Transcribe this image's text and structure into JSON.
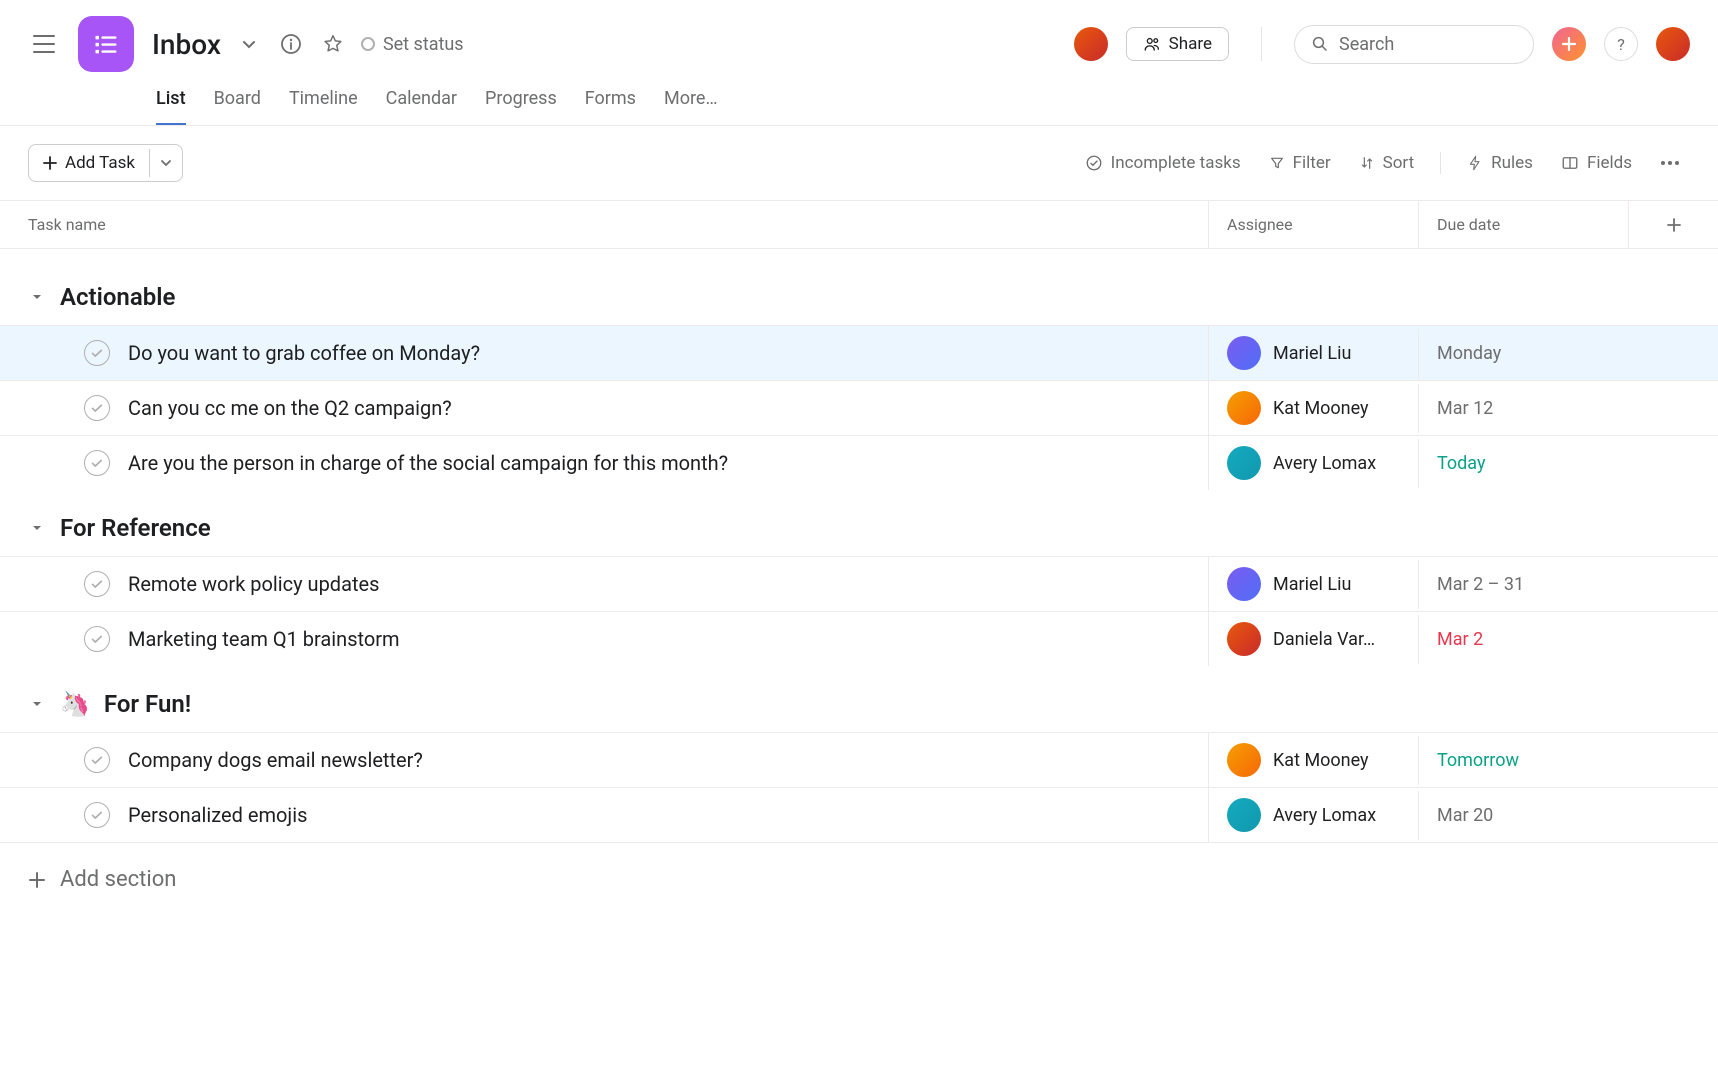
{
  "header": {
    "title": "Inbox",
    "set_status": "Set status",
    "share": "Share",
    "search_placeholder": "Search",
    "help": "?"
  },
  "tabs": {
    "items": [
      {
        "label": "List",
        "active": true
      },
      {
        "label": "Board",
        "active": false
      },
      {
        "label": "Timeline",
        "active": false
      },
      {
        "label": "Calendar",
        "active": false
      },
      {
        "label": "Progress",
        "active": false
      },
      {
        "label": "Forms",
        "active": false
      },
      {
        "label": "More…",
        "active": false
      }
    ]
  },
  "toolbar": {
    "add_task": "Add Task",
    "incomplete": "Incomplete tasks",
    "filter": "Filter",
    "sort": "Sort",
    "rules": "Rules",
    "fields": "Fields"
  },
  "columns": {
    "name": "Task name",
    "assignee": "Assignee",
    "due": "Due date"
  },
  "avatars": {
    "mariel": {
      "cls": "av-purple"
    },
    "kat": {
      "cls": "av-orange"
    },
    "avery": {
      "cls": "av-teal"
    },
    "daniela": {
      "cls": "av-red"
    }
  },
  "sections": [
    {
      "title": "Actionable",
      "emoji": "",
      "tasks": [
        {
          "name": "Do you want to grab coffee on Monday?",
          "assignee": "Mariel Liu",
          "avatar": "mariel",
          "due": "Monday",
          "due_cls": "",
          "selected": true
        },
        {
          "name": "Can you cc me on the Q2 campaign?",
          "assignee": "Kat Mooney",
          "avatar": "kat",
          "due": "Mar 12",
          "due_cls": "",
          "selected": false
        },
        {
          "name": "Are you the person in charge of the social campaign for this month?",
          "assignee": "Avery Lomax",
          "avatar": "avery",
          "due": "Today",
          "due_cls": "due-today",
          "selected": false
        }
      ]
    },
    {
      "title": "For Reference",
      "emoji": "",
      "tasks": [
        {
          "name": "Remote work policy updates",
          "assignee": "Mariel Liu",
          "avatar": "mariel",
          "due": "Mar 2 – 31",
          "due_cls": "",
          "selected": false
        },
        {
          "name": "Marketing team Q1 brainstorm",
          "assignee": "Daniela Var…",
          "avatar": "daniela",
          "due": "Mar 2",
          "due_cls": "due-overdue",
          "selected": false
        }
      ]
    },
    {
      "title": "For Fun!",
      "emoji": "🦄",
      "tasks": [
        {
          "name": "Company dogs email newsletter?",
          "assignee": "Kat Mooney",
          "avatar": "kat",
          "due": "Tomorrow",
          "due_cls": "due-today",
          "selected": false
        },
        {
          "name": "Personalized emojis",
          "assignee": "Avery Lomax",
          "avatar": "avery",
          "due": "Mar 20",
          "due_cls": "",
          "selected": false
        }
      ]
    }
  ],
  "add_section": "Add section"
}
